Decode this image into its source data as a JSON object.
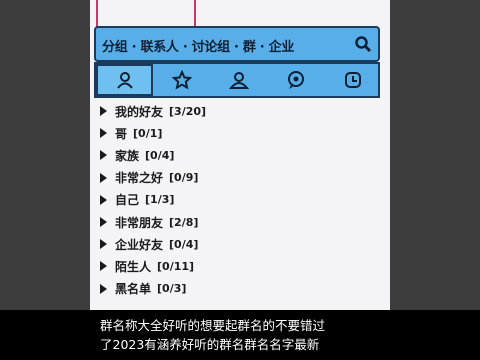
{
  "search": {
    "text": "分组 · 联系人 · 讨论组 · 群 · 企业"
  },
  "tabs": [
    {
      "icon": "contact-icon",
      "active": true
    },
    {
      "icon": "star-icon",
      "active": false
    },
    {
      "icon": "group-icon",
      "active": false
    },
    {
      "icon": "chat-icon",
      "active": false
    },
    {
      "icon": "history-icon",
      "active": false
    }
  ],
  "groups": [
    {
      "name": "我的好友",
      "count": "[3/20]"
    },
    {
      "name": "哥",
      "count": "[0/1]"
    },
    {
      "name": "家族",
      "count": "[0/4]"
    },
    {
      "name": "非常之好",
      "count": "[0/9]"
    },
    {
      "name": "自己",
      "count": "[1/3]"
    },
    {
      "name": "非常朋友",
      "count": "[2/8]"
    },
    {
      "name": "企业好友",
      "count": "[0/4]"
    },
    {
      "name": "陌生人",
      "count": "[0/11]"
    },
    {
      "name": "黑名单",
      "count": "[0/3]"
    }
  ],
  "caption": {
    "line1": "群名称大全好听的想要起群名的不要错过",
    "line2": "了2023有涵养好听的群名群名名字最新"
  }
}
